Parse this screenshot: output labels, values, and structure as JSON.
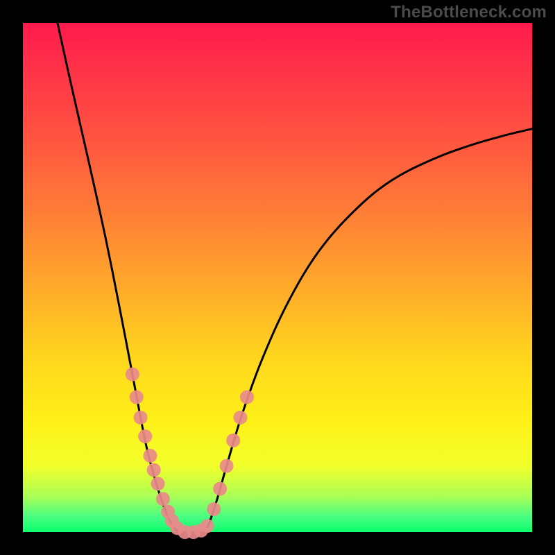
{
  "watermark": "TheBottleneck.com",
  "chart_data": {
    "type": "line",
    "title": "",
    "xlabel": "",
    "ylabel": "",
    "xlim": [
      0,
      1
    ],
    "ylim": [
      0,
      1
    ],
    "grid": false,
    "legend": false,
    "background_gradient": {
      "top": "#ff1a4d",
      "middle": "#ffd41e",
      "bottom": "#0bff6c"
    },
    "series": [
      {
        "name": "curve-left",
        "color": "#000000",
        "x": [
          0.068,
          0.09,
          0.115,
          0.14,
          0.165,
          0.19,
          0.215,
          0.24,
          0.255,
          0.27,
          0.285,
          0.3
        ],
        "y": [
          1.0,
          0.9,
          0.79,
          0.68,
          0.565,
          0.44,
          0.31,
          0.18,
          0.12,
          0.07,
          0.03,
          0.005
        ]
      },
      {
        "name": "curve-floor",
        "color": "#000000",
        "x": [
          0.3,
          0.315,
          0.33,
          0.345,
          0.36
        ],
        "y": [
          0.005,
          0.0,
          0.0,
          0.0,
          0.005
        ]
      },
      {
        "name": "curve-right",
        "color": "#000000",
        "x": [
          0.36,
          0.38,
          0.4,
          0.43,
          0.47,
          0.52,
          0.58,
          0.65,
          0.72,
          0.8,
          0.88,
          0.95,
          1.0
        ],
        "y": [
          0.005,
          0.06,
          0.13,
          0.23,
          0.34,
          0.45,
          0.55,
          0.63,
          0.688,
          0.73,
          0.76,
          0.78,
          0.792
        ]
      }
    ],
    "markers": [
      {
        "name": "points-left",
        "color": "#e98a8a",
        "x": [
          0.215,
          0.223,
          0.231,
          0.24,
          0.25,
          0.257,
          0.265,
          0.275,
          0.285,
          0.293,
          0.303,
          0.318,
          0.335,
          0.35
        ],
        "y": [
          0.31,
          0.265,
          0.225,
          0.188,
          0.15,
          0.122,
          0.095,
          0.065,
          0.04,
          0.022,
          0.008,
          0.0,
          0.0,
          0.003
        ]
      },
      {
        "name": "points-right",
        "color": "#e98a8a",
        "x": [
          0.362,
          0.375,
          0.387,
          0.4,
          0.413,
          0.427,
          0.44
        ],
        "y": [
          0.012,
          0.045,
          0.085,
          0.13,
          0.18,
          0.225,
          0.265
        ]
      }
    ]
  }
}
